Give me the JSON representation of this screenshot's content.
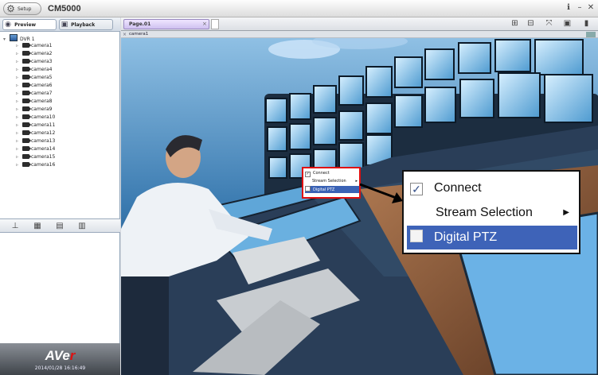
{
  "titlebar": {
    "setup_label": "Setup",
    "app_title": "CM5000",
    "help_icon": "help-icon",
    "minimize_icon": "minimize-icon",
    "close_icon": "close-icon"
  },
  "left_panel": {
    "tabs": [
      {
        "label": "Preview",
        "icon": "eye-icon"
      },
      {
        "label": "Playback",
        "icon": "film-icon"
      }
    ],
    "tree": {
      "root": "DVR 1",
      "cameras": [
        "camera1",
        "camera2",
        "camera3",
        "camera4",
        "camera5",
        "camera6",
        "camera7",
        "camera8",
        "camera9",
        "camera10",
        "camera11",
        "camera12",
        "camera13",
        "camera14",
        "camera15",
        "camera16"
      ]
    },
    "tools": [
      "ptz-icon",
      "snapshot-icon",
      "stream-icon",
      "folder-icon"
    ],
    "brand": {
      "logo_prefix": "AVe",
      "logo_suffix": "r",
      "datetime": "2014/01/28 16:16:49"
    }
  },
  "main": {
    "page_tab": {
      "label": "Page.01"
    },
    "layout_icons": [
      "grid-icon",
      "split-icon",
      "fullscreen-icon",
      "save-icon",
      "delete-icon"
    ],
    "channel_label": "camera1"
  },
  "context_menu": {
    "items": [
      {
        "label": "Connect",
        "checked": true
      },
      {
        "label": "Stream Selection",
        "submenu": true
      },
      {
        "label": "Digital PTZ",
        "checked": false,
        "highlighted": true
      }
    ],
    "highlight_color": "#3e63b8",
    "callout_color": "#e01010"
  }
}
